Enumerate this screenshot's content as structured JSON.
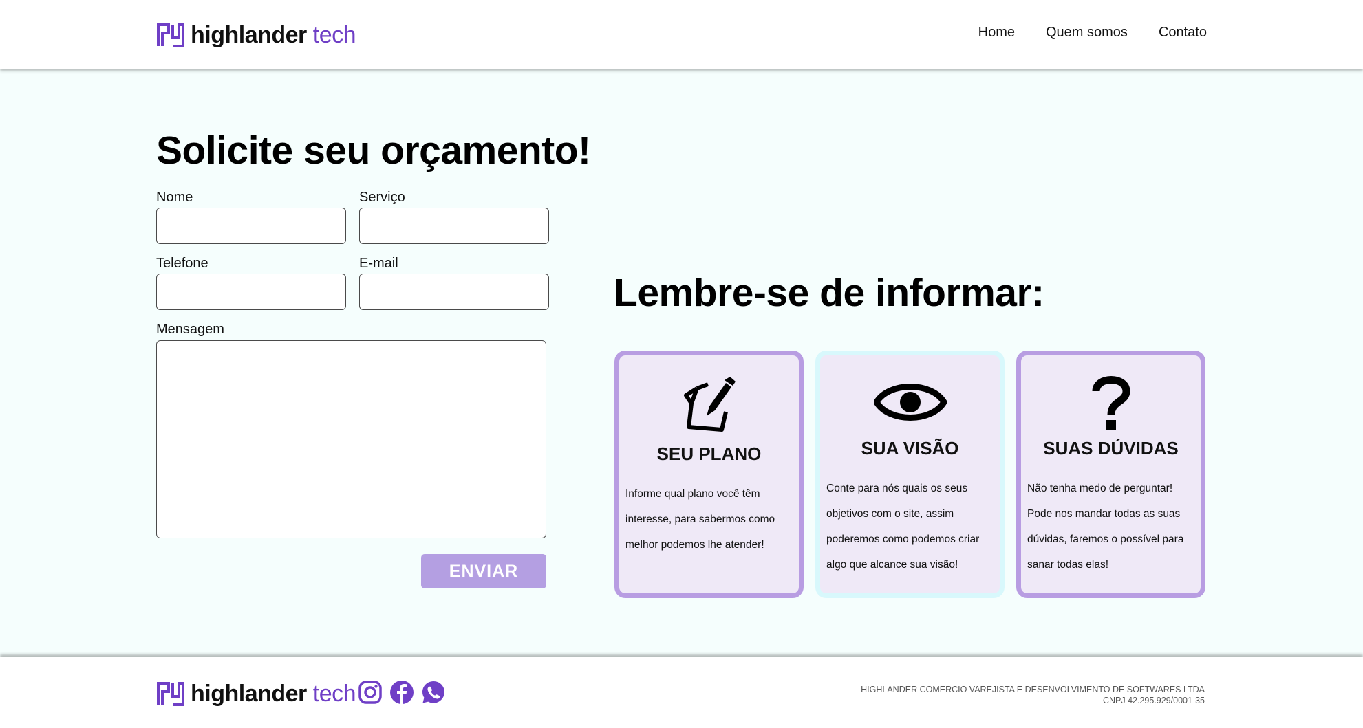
{
  "brand": {
    "name_bold": "highlander",
    "name_light": "tech",
    "accent_color": "#6f3fc6"
  },
  "nav": {
    "items": [
      "Home",
      "Quem somos",
      "Contato"
    ]
  },
  "form": {
    "title": "Solicite seu orçamento!",
    "labels": {
      "nome": "Nome",
      "servico": "Serviço",
      "telefone": "Telefone",
      "email": "E-mail",
      "mensagem": "Mensagem"
    },
    "values": {
      "nome": "",
      "servico": "",
      "telefone": "",
      "email": "",
      "mensagem": ""
    },
    "submit_label": "ENVIAR",
    "submit_color": "#b49fe2"
  },
  "reminder": {
    "title": "Lembre-se de informar:",
    "cards": [
      {
        "icon": "document-pen-icon",
        "title": "SEU PLANO",
        "lines": [
          "Informe qual plano você têm",
          "interesse, para sabermos como",
          "melhor podemos lhe atender!"
        ]
      },
      {
        "icon": "eye-icon",
        "title": "SUA VISÃO",
        "lines": [
          "Conte para nós quais os seus",
          "objetivos com o site, assim",
          "poderemos como podemos criar",
          "algo que alcance sua visão!"
        ]
      },
      {
        "icon": "question-mark-icon",
        "title": "SUAS DÚVIDAS",
        "lines": [
          "Não tenha medo de perguntar!",
          "Pode nos mandar todas as suas",
          "dúvidas, faremos o possível para",
          "sanar todas elas!"
        ]
      }
    ]
  },
  "footer": {
    "socials": [
      "instagram-icon",
      "facebook-icon",
      "whatsapp-icon"
    ],
    "company": "HIGHLANDER COMERCIO VAREJISTA E DESENVOLVIMENTO DE SOFTWARES LTDA",
    "cnpj": "CNPJ 42.295.929/0001-35"
  }
}
